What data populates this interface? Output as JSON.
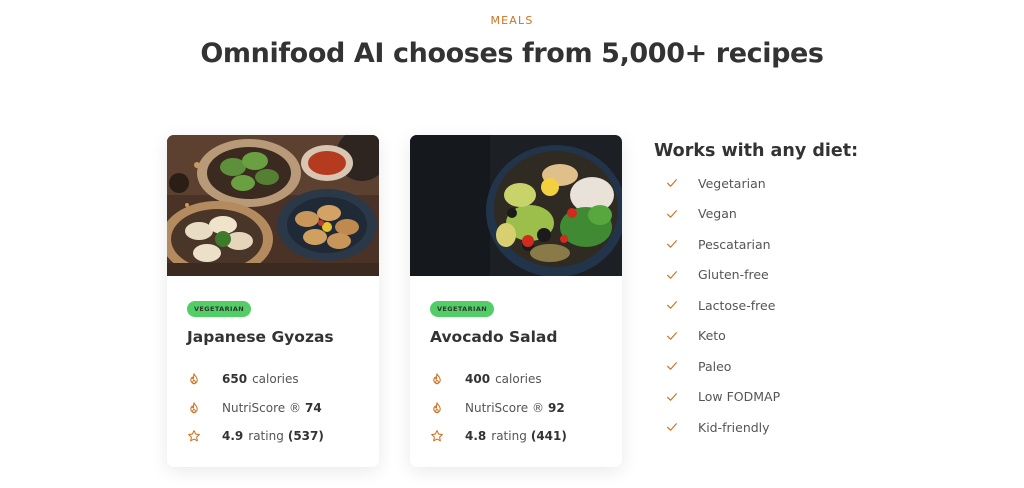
{
  "section": {
    "subheading": "MEALS",
    "heading": "Omnifood AI chooses from 5,000+ recipes"
  },
  "meals": [
    {
      "image_alt": "Japanese Gyozas",
      "tag": "VEGETARIAN",
      "title": "Japanese Gyozas",
      "calories_value": "650",
      "calories_label": "calories",
      "nutri_label": "NutriScore ®",
      "nutri_value": "74",
      "rating_value": "4.9",
      "rating_label": "rating",
      "rating_count": "(537)"
    },
    {
      "image_alt": "Avocado Salad",
      "tag": "VEGETARIAN",
      "title": "Avocado Salad",
      "calories_value": "400",
      "calories_label": "calories",
      "nutri_label": "NutriScore ®",
      "nutri_value": "92",
      "rating_value": "4.8",
      "rating_label": "rating",
      "rating_count": "(441)"
    }
  ],
  "diets": {
    "title": "Works with any diet:",
    "items": [
      "Vegetarian",
      "Vegan",
      "Pescatarian",
      "Gluten-free",
      "Lactose-free",
      "Keto",
      "Paleo",
      "Low FODMAP",
      "Kid-friendly"
    ]
  },
  "colors": {
    "accent": "#cf711f",
    "tag_green": "#51cf66",
    "text_dark": "#333333",
    "text_muted": "#555555"
  },
  "icons": {
    "calories": "flame-icon",
    "nutriscore": "flame-icon",
    "rating": "star-icon",
    "diet_item": "checkmark-icon"
  }
}
